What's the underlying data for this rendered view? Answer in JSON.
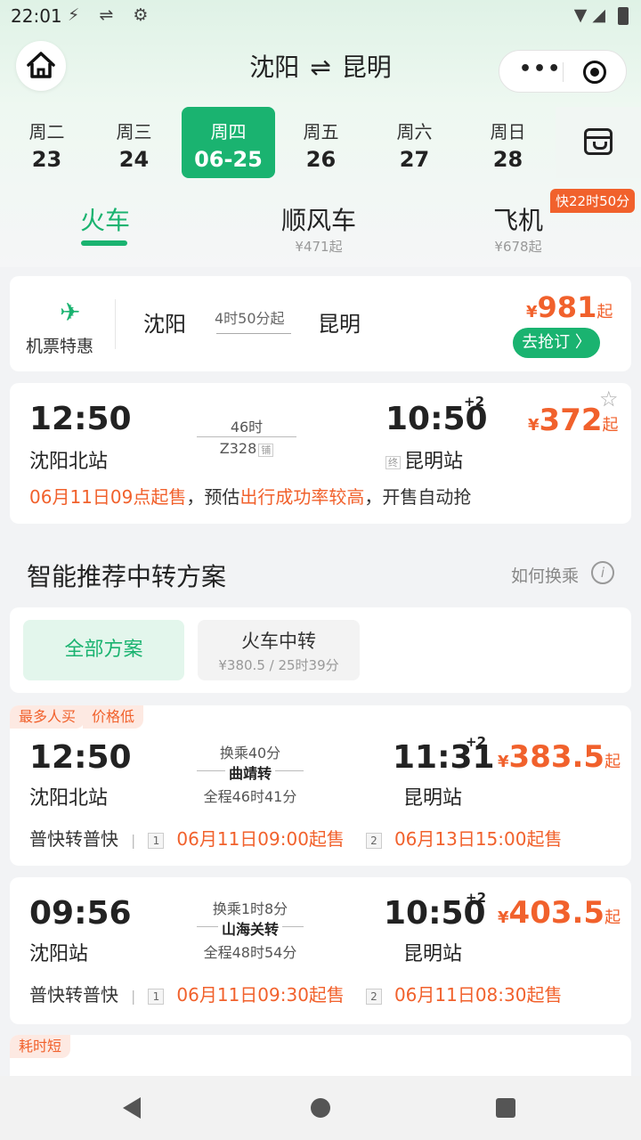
{
  "status": {
    "time": "22:01",
    "left_icons": "⚡ ⇌ ⚙",
    "right_icons": "▼ ◢"
  },
  "header": {
    "from": "沈阳",
    "swap": "⇌",
    "to": "昆明",
    "menu_dots": "•••"
  },
  "dates": [
    {
      "weekday": "周二",
      "date": "23"
    },
    {
      "weekday": "周三",
      "date": "24"
    },
    {
      "weekday": "周四",
      "date": "06-25",
      "active": true
    },
    {
      "weekday": "周五",
      "date": "26"
    },
    {
      "weekday": "周六",
      "date": "27"
    },
    {
      "weekday": "周日",
      "date": "28"
    }
  ],
  "modes": [
    {
      "label": "火车",
      "sub": ""
    },
    {
      "label": "顺风车",
      "sub": "¥471起"
    },
    {
      "label": "飞机",
      "sub": "¥678起"
    }
  ],
  "fast_badge": "快22时50分",
  "promo": {
    "icon": "✈",
    "label": "机票特惠",
    "from": "沈阳",
    "duration": "4时50分起",
    "to": "昆明",
    "yen": "¥",
    "price": "981",
    "suffix": "起",
    "button": "去抢订 〉"
  },
  "train": {
    "dep_time": "12:50",
    "dep_station": "沈阳北站",
    "duration": "46时",
    "train_no": "Z328",
    "berth_tag": "铺",
    "arr_time": "10:50",
    "plus_days": "+2",
    "end_tag": "终",
    "arr_station": "昆明站",
    "yen": "¥",
    "price": "372",
    "suffix": "起",
    "star": "☆",
    "note_a": "06月11日09点起售",
    "note_b": "，预估",
    "note_c": "出行成功率较高",
    "note_d": "，开售自动抢"
  },
  "section": {
    "title": "智能推荐中转方案",
    "howto": "如何换乘",
    "info": "i"
  },
  "filters": {
    "all": "全部方案",
    "train_title": "火车中转",
    "train_sub": "¥380.5 / 25时39分"
  },
  "transfers": [
    {
      "badges": [
        "最多人买",
        "价格低"
      ],
      "dep_time": "12:50",
      "dep_station": "沈阳北站",
      "transfer_wait": "换乘40分",
      "transfer_city": "曲靖转",
      "total": "全程46时41分",
      "arr_time": "11:31",
      "plus_days": "+2",
      "arr_station": "昆明站",
      "yen": "¥",
      "price": "383.5",
      "suffix": "起",
      "type": "普快转普快",
      "sep": "|",
      "seg1": "1",
      "sale1": "06月11日09:00起售",
      "seg2": "2",
      "sale2": "06月13日15:00起售"
    },
    {
      "dep_time": "09:56",
      "dep_station": "沈阳站",
      "transfer_wait": "换乘1时8分",
      "transfer_city": "山海关转",
      "total": "全程48时54分",
      "arr_time": "10:50",
      "plus_days": "+2",
      "arr_station": "昆明站",
      "yen": "¥",
      "price": "403.5",
      "suffix": "起",
      "type": "普快转普快",
      "sep": "|",
      "seg1": "1",
      "sale1": "06月11日09:30起售",
      "seg2": "2",
      "sale2": "06月11日08:30起售"
    }
  ],
  "third_badge": "耗时短",
  "colors": {
    "accent": "#1ab370",
    "price": "#f1612c"
  }
}
